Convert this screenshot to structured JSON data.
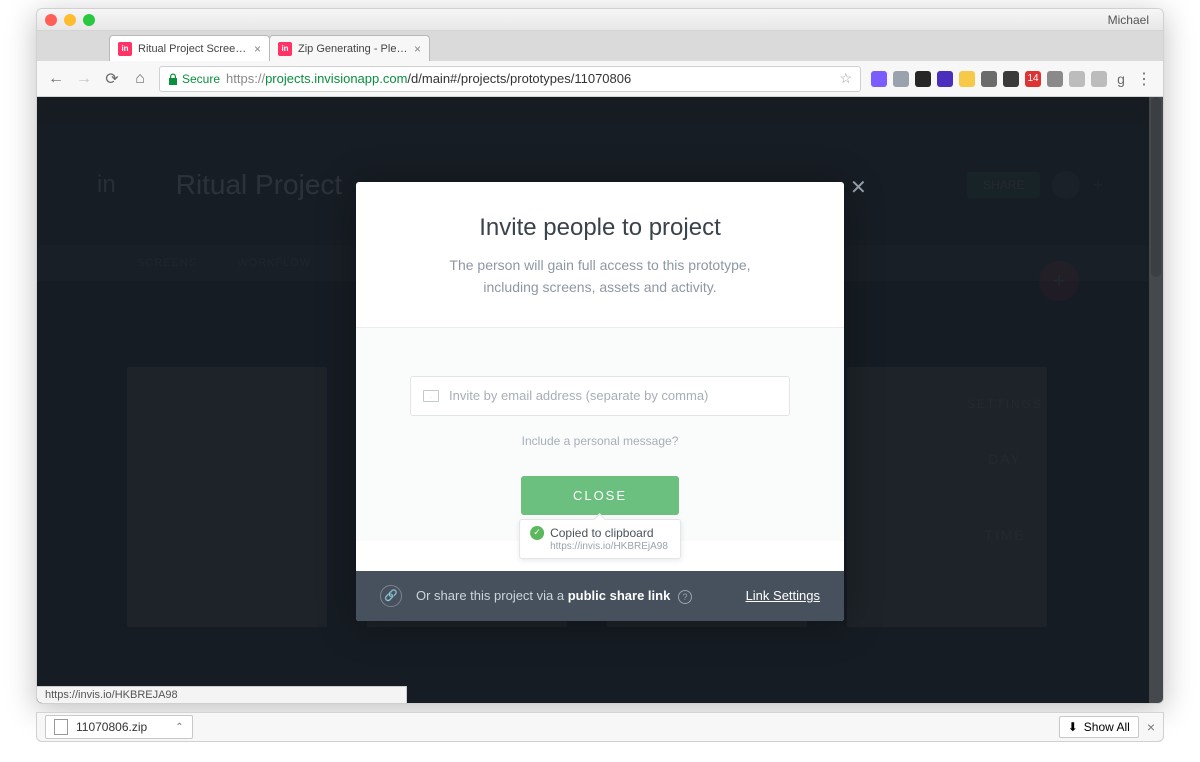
{
  "mac": {
    "user": "Michael"
  },
  "browser": {
    "tabs": [
      {
        "title": "Ritual Project Screens - InVisio"
      },
      {
        "title": "Zip Generating - Please Wait..."
      }
    ],
    "secure_label": "Secure",
    "url_scheme": "https://",
    "url_host": "projects.invisionapp.com",
    "url_path": "/d/main#/projects/prototypes/11070806",
    "status_url": "https://invis.io/HKBREJA98"
  },
  "app": {
    "logo_text": "in",
    "project_title": "Ritual Project",
    "share_label": "SHARE",
    "nav": {
      "screens": "SCREENS",
      "workflow": "WORKFLOW"
    }
  },
  "modal": {
    "title": "Invite people to project",
    "subtitle1": "The person will gain full access to this prototype,",
    "subtitle2": "including screens, assets and activity.",
    "email_placeholder": "Invite by email address (separate by comma)",
    "personal_message_link": "Include a personal message?",
    "close_button": "CLOSE",
    "tooltip": {
      "title": "Copied to clipboard",
      "url": "https://invis.io/HKBREjA98"
    },
    "footer": {
      "prefix": "Or share this project via a ",
      "bold": "public share link",
      "link_settings": "Link Settings"
    }
  },
  "downloads": {
    "file": "11070806.zip",
    "show_all": "Show All"
  },
  "bg": {
    "settings": "SETTINGS",
    "day": "DAY",
    "time": "TIME"
  }
}
